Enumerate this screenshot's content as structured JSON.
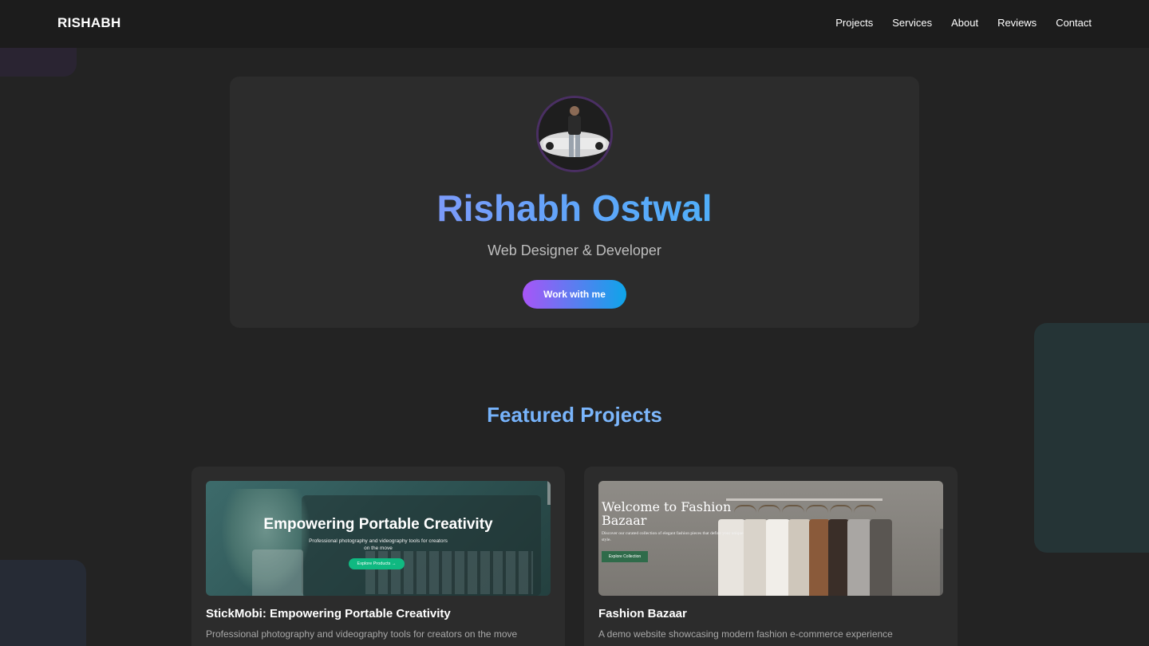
{
  "nav": {
    "brand": "RISHABH",
    "links": [
      "Projects",
      "Services",
      "About",
      "Reviews",
      "Contact"
    ]
  },
  "hero": {
    "avatar_icon": "profile-photo",
    "name": "Rishabh Ostwal",
    "role": "Web Designer & Developer",
    "cta": "Work with me"
  },
  "featured": {
    "title": "Featured Projects",
    "projects": [
      {
        "title": "StickMobi: Empowering Portable Creativity",
        "description": "Professional photography and videography tools for creators on the move",
        "thumbnail": {
          "headline": "Empowering Portable Creativity",
          "subtext": "Professional photography and videography tools for creators on the move",
          "button": "Explore Products →"
        }
      },
      {
        "title": "Fashion Bazaar",
        "description": "A demo website showcasing modern fashion e-commerce experience",
        "thumbnail": {
          "headline": "Welcome to Fashion Bazaar",
          "subtext": "Discover our curated collection of elegant fashion pieces that define your unique style.",
          "button": "Explore Collection"
        }
      }
    ]
  },
  "colors": {
    "background": "#232323",
    "card": "#2c2c2c",
    "accent_purple": "#a855f7",
    "accent_blue": "#0ea5e9"
  }
}
